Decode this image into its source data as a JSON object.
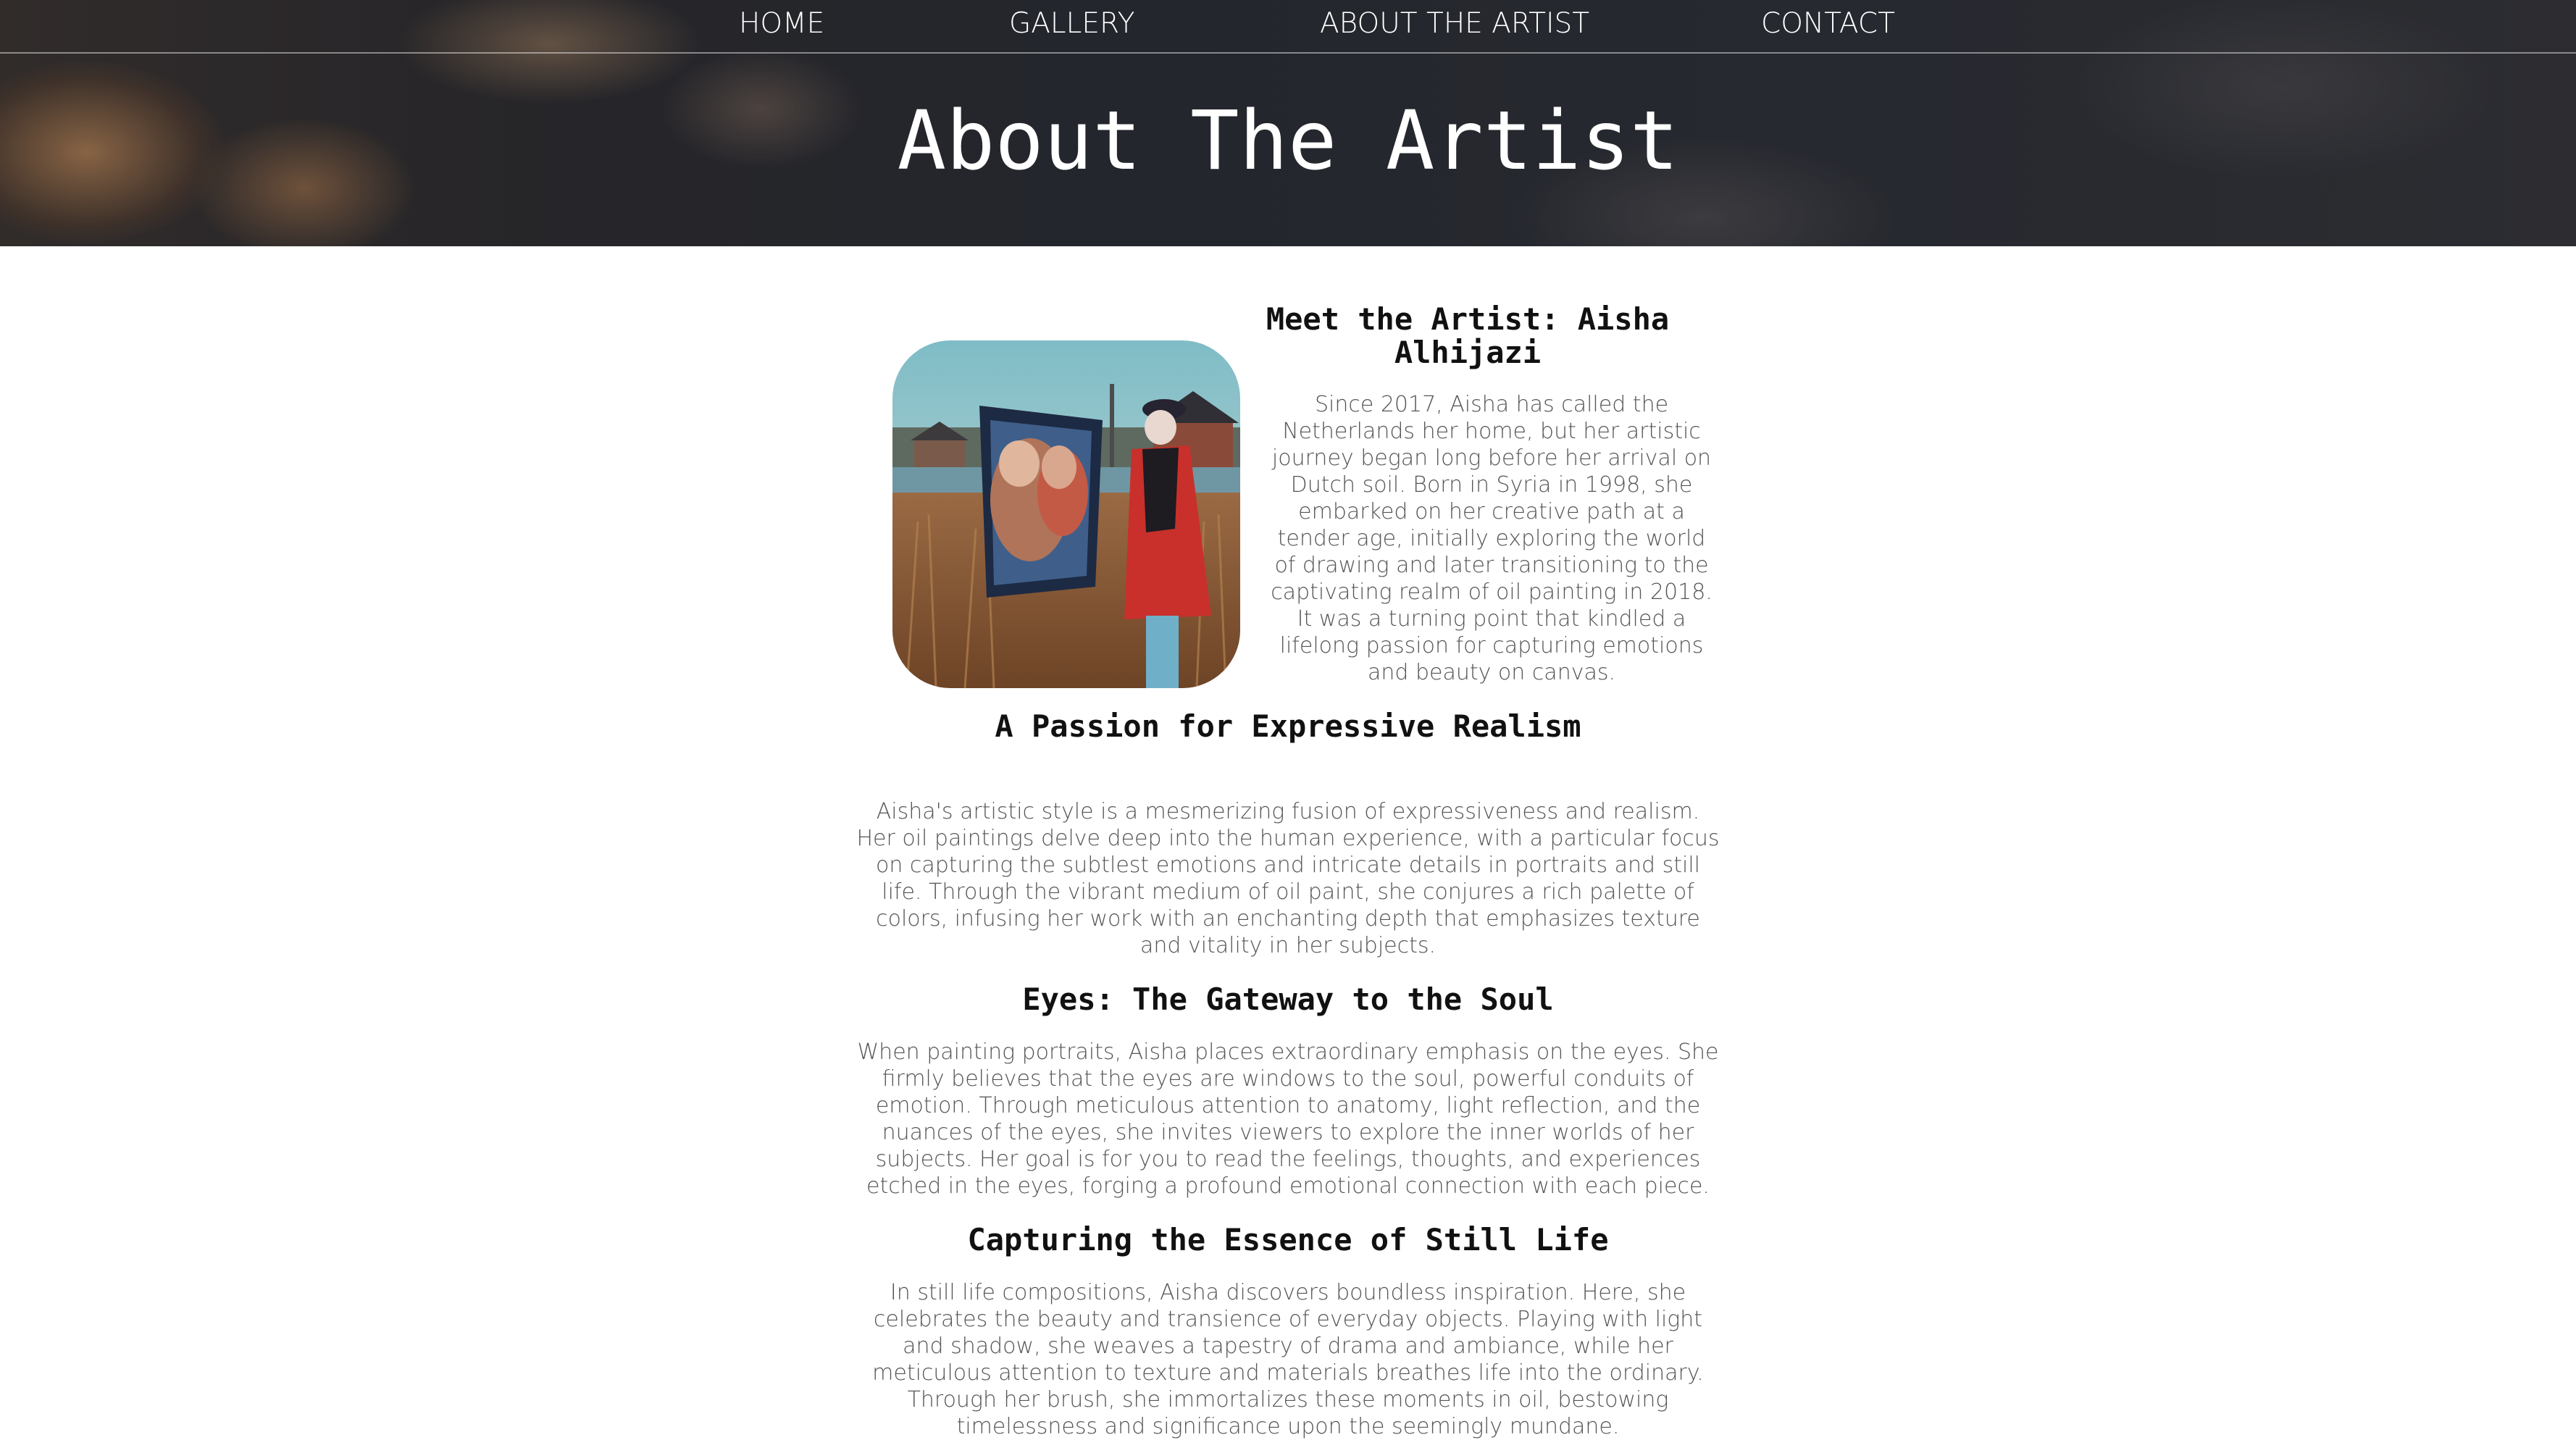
{
  "nav": {
    "items": [
      {
        "label": "HOME"
      },
      {
        "label": "GALLERY"
      },
      {
        "label": "ABOUT THE ARTIST"
      },
      {
        "label": "CONTACT"
      }
    ]
  },
  "hero": {
    "title": "About The Artist"
  },
  "sections": [
    {
      "title": "Meet the Artist: Aisha Alhijazi",
      "text": "Since 2017, Aisha has called the Netherlands her home, but her artistic journey began long before her arrival on Dutch soil. Born in Syria in 1998, she embarked on her creative path at a tender age, initially exploring the world of drawing and later transitioning to the captivating realm of oil painting in 2018. It was a turning point that kindled a lifelong passion for capturing emotions and beauty on canvas."
    },
    {
      "title": "A Passion for Expressive Realism",
      "text": "Aisha's artistic style is a mesmerizing fusion of expressiveness and realism. Her oil paintings delve deep into the human experience, with a particular focus on capturing the subtlest emotions and intricate details in portraits and still life. Through the vibrant medium of oil paint, she conjures a rich palette of colors, infusing her work with an enchanting depth that emphasizes texture and vitality in her subjects."
    },
    {
      "title": "Eyes: The Gateway to the Soul",
      "text": "When painting portraits, Aisha places extraordinary emphasis on the eyes. She firmly believes that the eyes are windows to the soul, powerful conduits of emotion. Through meticulous attention to anatomy, light reflection, and the nuances of the eyes, she invites viewers to explore the inner worlds of her subjects. Her goal is for you to read the feelings, thoughts, and experiences etched in the eyes, forging a profound emotional connection with each piece."
    },
    {
      "title": "Capturing the Essence of Still Life",
      "text": "In still life compositions, Aisha discovers boundless inspiration. Here, she celebrates the beauty and transience of everyday objects. Playing with light and shadow, she weaves a tapestry of drama and ambiance, while her meticulous attention to texture and materials breathes life into the ordinary. Through her brush, she immortalizes these moments in oil, bestowing timelessness and significance upon the seemingly mundane."
    }
  ]
}
